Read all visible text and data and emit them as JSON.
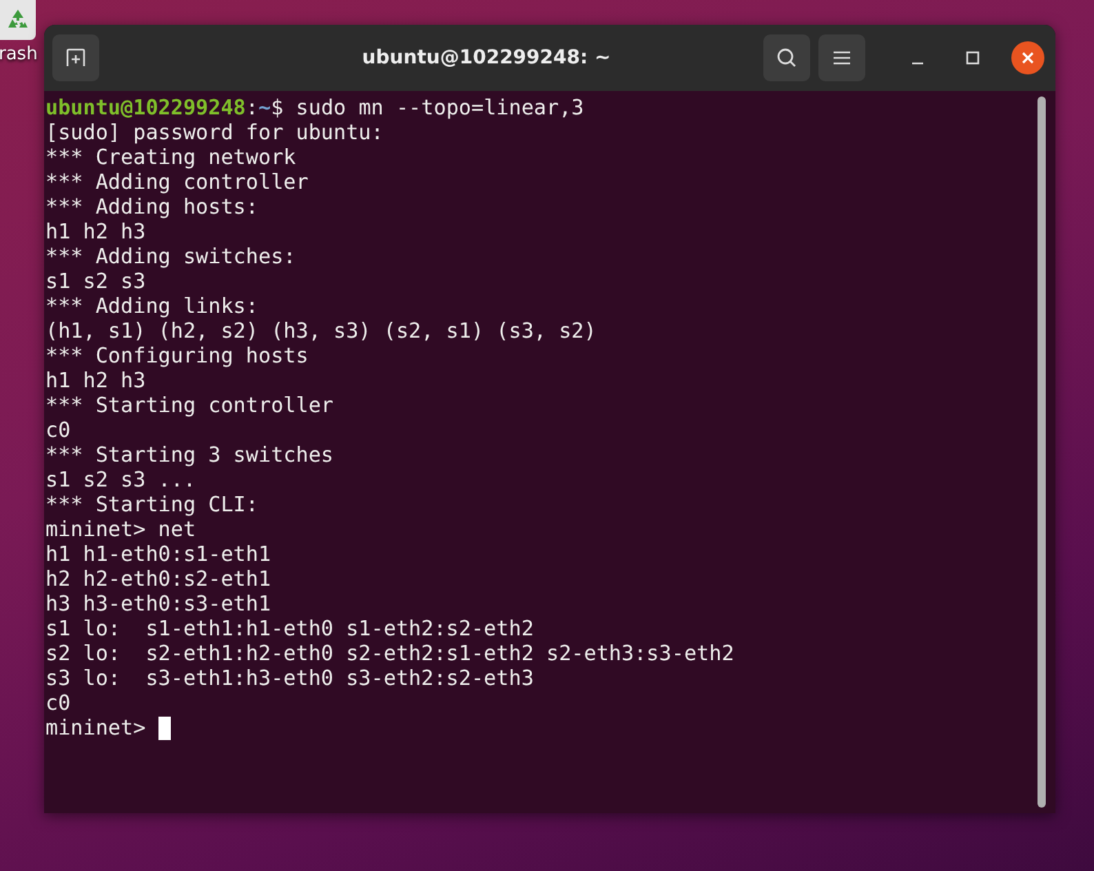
{
  "desktop": {
    "icon_label": "rash"
  },
  "window": {
    "title": "ubuntu@102299248: ~"
  },
  "terminal": {
    "lines": [
      {
        "kind": "prompt",
        "user_host": "ubuntu@102299248",
        "separator": ":",
        "path": "~",
        "command": "$ sudo mn --topo=linear,3"
      },
      {
        "kind": "output",
        "text": "[sudo] password for ubuntu:"
      },
      {
        "kind": "output",
        "text": "*** Creating network"
      },
      {
        "kind": "output",
        "text": "*** Adding controller"
      },
      {
        "kind": "output",
        "text": "*** Adding hosts:"
      },
      {
        "kind": "output",
        "text": "h1 h2 h3"
      },
      {
        "kind": "output",
        "text": "*** Adding switches:"
      },
      {
        "kind": "output",
        "text": "s1 s2 s3"
      },
      {
        "kind": "output",
        "text": "*** Adding links:"
      },
      {
        "kind": "output",
        "text": "(h1, s1) (h2, s2) (h3, s3) (s2, s1) (s3, s2)"
      },
      {
        "kind": "output",
        "text": "*** Configuring hosts"
      },
      {
        "kind": "output",
        "text": "h1 h2 h3"
      },
      {
        "kind": "output",
        "text": "*** Starting controller"
      },
      {
        "kind": "output",
        "text": "c0"
      },
      {
        "kind": "output",
        "text": "*** Starting 3 switches"
      },
      {
        "kind": "output",
        "text": "s1 s2 s3 ..."
      },
      {
        "kind": "output",
        "text": "*** Starting CLI:"
      },
      {
        "kind": "output",
        "text": "mininet> net"
      },
      {
        "kind": "output",
        "text": "h1 h1-eth0:s1-eth1"
      },
      {
        "kind": "output",
        "text": "h2 h2-eth0:s2-eth1"
      },
      {
        "kind": "output",
        "text": "h3 h3-eth0:s3-eth1"
      },
      {
        "kind": "output",
        "text": "s1 lo:  s1-eth1:h1-eth0 s1-eth2:s2-eth2"
      },
      {
        "kind": "output",
        "text": "s2 lo:  s2-eth1:h2-eth0 s2-eth2:s1-eth2 s2-eth3:s3-eth2"
      },
      {
        "kind": "output",
        "text": "s3 lo:  s3-eth1:h3-eth0 s3-eth2:s2-eth3"
      },
      {
        "kind": "output",
        "text": "c0"
      },
      {
        "kind": "output",
        "text": "mininet>",
        "cursor": true
      }
    ]
  }
}
